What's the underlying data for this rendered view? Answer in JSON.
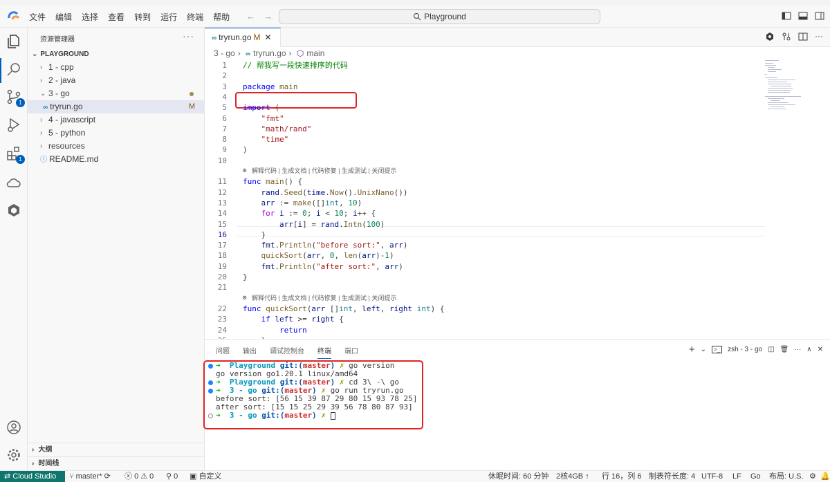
{
  "menu": [
    "文件",
    "编辑",
    "选择",
    "查看",
    "转到",
    "运行",
    "终端",
    "帮助"
  ],
  "command_center": "Playground",
  "sidebar": {
    "title": "资源管理器",
    "root": "PLAYGROUND",
    "items": [
      {
        "label": "1 - cpp",
        "type": "folder",
        "expanded": false
      },
      {
        "label": "2 - java",
        "type": "folder",
        "expanded": false
      },
      {
        "label": "3 - go",
        "type": "folder",
        "expanded": true
      },
      {
        "label": "tryrun.go",
        "type": "file",
        "status": "M"
      },
      {
        "label": "4 - javascript",
        "type": "folder",
        "expanded": false
      },
      {
        "label": "5 - python",
        "type": "folder",
        "expanded": false
      },
      {
        "label": "resources",
        "type": "folder",
        "expanded": false
      },
      {
        "label": "README.md",
        "type": "file"
      }
    ],
    "outline": "大纲",
    "timeline": "时间线"
  },
  "activity_badges": {
    "scm": "1",
    "extensions": "1"
  },
  "tab": {
    "label": "tryrun.go",
    "status": "M",
    "icon": "go-file-icon"
  },
  "breadcrumb": [
    "3 - go",
    "tryrun.go",
    "main"
  ],
  "code_lens": "解释代码 | 生成文档 | 代码修复 | 生成测试 | 关闭提示",
  "code_lines": [
    {
      "n": "1",
      "text": "// 帮我写一段快速排序的代码"
    },
    {
      "n": "2",
      "text": ""
    },
    {
      "n": "3",
      "text": "package main"
    },
    {
      "n": "4",
      "text": ""
    },
    {
      "n": "5",
      "text": "import ("
    },
    {
      "n": "6",
      "text": "    \"fmt\""
    },
    {
      "n": "7",
      "text": "    \"math/rand\""
    },
    {
      "n": "8",
      "text": "    \"time\""
    },
    {
      "n": "9",
      "text": ")"
    },
    {
      "n": "10",
      "text": ""
    },
    {
      "n": "11",
      "text": "func main() {"
    },
    {
      "n": "12",
      "text": "    rand.Seed(time.Now().UnixNano())"
    },
    {
      "n": "13",
      "text": "    arr := make([]int, 10)"
    },
    {
      "n": "14",
      "text": "    for i := 0; i < 10; i++ {"
    },
    {
      "n": "15",
      "text": "        arr[i] = rand.Intn(100)"
    },
    {
      "n": "16",
      "text": "    }"
    },
    {
      "n": "17",
      "text": "    fmt.Println(\"before sort:\", arr)"
    },
    {
      "n": "18",
      "text": "    quickSort(arr, 0, len(arr)-1)"
    },
    {
      "n": "19",
      "text": "    fmt.Println(\"after sort:\", arr)"
    },
    {
      "n": "20",
      "text": "}"
    },
    {
      "n": "21",
      "text": ""
    },
    {
      "n": "22",
      "text": "func quickSort(arr []int, left, right int) {"
    },
    {
      "n": "23",
      "text": "    if left >= right {"
    },
    {
      "n": "24",
      "text": "        return"
    },
    {
      "n": "25",
      "text": "    }"
    }
  ],
  "current_line": "16",
  "panel": {
    "tabs": [
      "问题",
      "输出",
      "调试控制台",
      "终端",
      "端口"
    ],
    "active_tab": "终端",
    "terminal_name": "zsh - 3 - go"
  },
  "terminal": [
    {
      "dot": "blue",
      "dir": "Playground",
      "git": "git:(",
      "branch": "master",
      "git_end": ")",
      "x": "✗",
      "cmd": "go version"
    },
    {
      "out": "go version go1.20.1 linux/amd64"
    },
    {
      "dot": "blue",
      "dir": "Playground",
      "git": "git:(",
      "branch": "master",
      "git_end": ")",
      "x": "✗",
      "cmd": "cd 3\\ -\\ go"
    },
    {
      "dot": "blue",
      "dir": "3 - go",
      "git": "git:(",
      "branch": "master",
      "git_end": ")",
      "x": "✗",
      "cmd": "go run tryrun.go"
    },
    {
      "out": "before sort: [56 15 39 87 29 80 15 93 78 25]"
    },
    {
      "out": "after sort: [15 15 25 29 39 56 78 80 87 93]"
    },
    {
      "dot": "empty",
      "dir": "3 - go",
      "git": "git:(",
      "branch": "master",
      "git_end": ")",
      "x": "✗",
      "cmd": ""
    }
  ],
  "status": {
    "remote": "Cloud Studio",
    "branch": "master*",
    "errors": "0",
    "warnings": "0",
    "ports": "0",
    "custom": "自定义",
    "rest": "休眠时间: 60 分钟",
    "machine": "2核4GB",
    "position": "行 16，列 6",
    "indent": "制表符长度: 4",
    "encoding": "UTF-8",
    "eol": "LF",
    "language": "Go",
    "layout": "布局: U.S."
  },
  "colors": {
    "accent": "#005fb8",
    "remote_bg": "#0f766e",
    "annotation": "#e02424"
  }
}
